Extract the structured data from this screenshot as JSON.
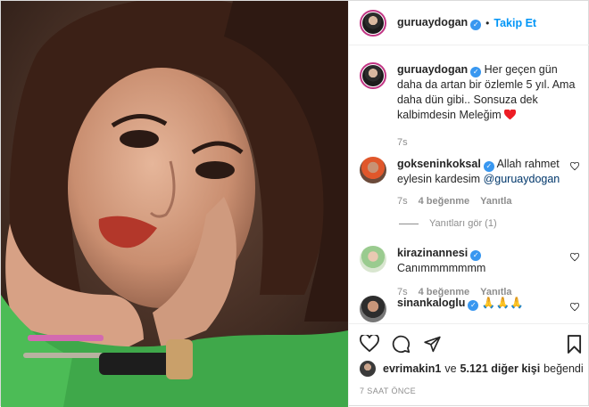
{
  "header": {
    "username": "guruaydogan",
    "follow_label": "Takip Et",
    "separator": "•"
  },
  "caption": {
    "username": "guruaydogan",
    "text": "Her geçen gün daha da artan bir özlemle 5 yıl. Ama daha dün gibi.. Sonsuza dek kalbimdesin Meleğim",
    "time": "7s"
  },
  "comments": [
    {
      "username": "gokseninkoksal",
      "text": "Allah rahmet eylesin kardesim ",
      "mention": "@guruaydogan",
      "time": "7s",
      "likes": "4 beğenme",
      "reply": "Yanıtla"
    },
    {
      "username": "kirazinannesi",
      "text": "Canımmmmmmm",
      "time": "7s",
      "likes": "4 beğenme",
      "reply": "Yanıtla"
    },
    {
      "username": "sinankaloglu",
      "text": "🙏🙏🙏"
    }
  ],
  "replies_label": "Yanıtları gör (1)",
  "likes": {
    "user": "evrimakin1",
    "connector": "ve",
    "others": "5.121 diğer kişi",
    "suffix": "beğendi"
  },
  "post_time": "7 SAAT ÖNCE",
  "colors": {
    "accent": "#0095f6",
    "heart": "#ed4956",
    "muted": "#8e8e8e"
  }
}
